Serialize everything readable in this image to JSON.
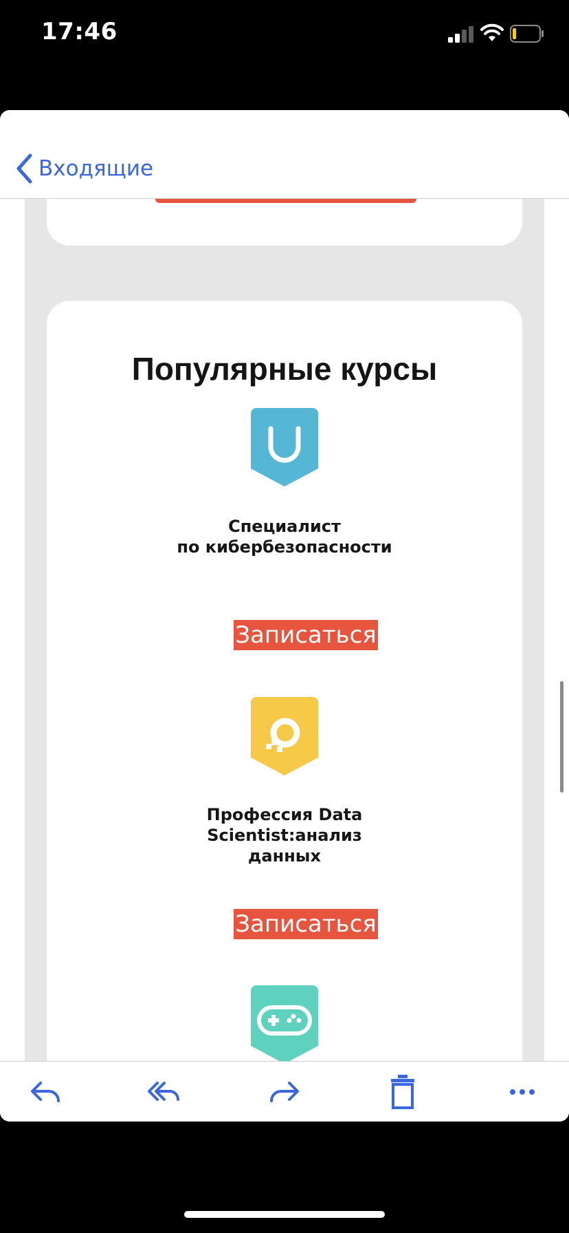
{
  "status_bar": {
    "time": "17:46"
  },
  "nav": {
    "back_label": "Входящие"
  },
  "section": {
    "title": "Популярные курсы"
  },
  "courses": [
    {
      "name_line1": "Специалист",
      "name_line2": "по кибербезопасности",
      "name_line3": "",
      "button": "Записаться",
      "icon": "cyber-shield-icon",
      "color": "#55b7d4"
    },
    {
      "name_line1": "Профессия Data",
      "name_line2": "Scientist:анализ",
      "name_line3": "данных",
      "button": "Записаться",
      "icon": "data-science-icon",
      "color": "#f7c948"
    },
    {
      "icon": "gamepad-icon",
      "color": "#5fd1bf"
    }
  ],
  "colors": {
    "accent": "#3a66e0",
    "button": "#e8553f",
    "background": "#e6e6e6"
  }
}
